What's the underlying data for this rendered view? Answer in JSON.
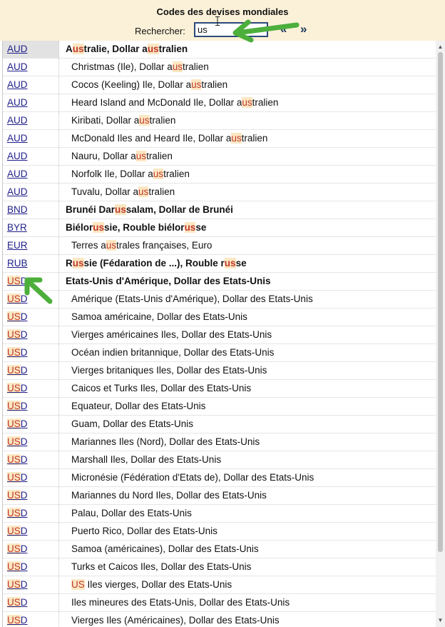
{
  "header": {
    "title": "Codes des devises mondiales",
    "search_label": "Rechercher:",
    "search_value": "us",
    "prev_label": "«",
    "next_label": "»"
  },
  "colors": {
    "header_bg": "#fbf1d8",
    "highlight_text": "#c0392b",
    "highlight_bg": "#fce7c2",
    "link": "#1f1f8a",
    "arrow": "#4caf3c"
  },
  "icons": [
    "text-cursor-icon",
    "scroll-up-icon",
    "scroll-down-icon",
    "pointer-arrow-icon"
  ],
  "rows": [
    {
      "code": "AUD",
      "name": "Australie, Dollar australien",
      "primary": true,
      "selected": true
    },
    {
      "code": "AUD",
      "name": "Christmas (Ile), Dollar australien",
      "primary": false
    },
    {
      "code": "AUD",
      "name": "Cocos (Keeling) Ile, Dollar australien",
      "primary": false
    },
    {
      "code": "AUD",
      "name": "Heard Island and McDonald Ile, Dollar australien",
      "primary": false
    },
    {
      "code": "AUD",
      "name": "Kiribati, Dollar australien",
      "primary": false
    },
    {
      "code": "AUD",
      "name": "McDonald Iles and Heard Ile, Dollar australien",
      "primary": false
    },
    {
      "code": "AUD",
      "name": "Nauru, Dollar australien",
      "primary": false
    },
    {
      "code": "AUD",
      "name": "Norfolk Ile, Dollar australien",
      "primary": false
    },
    {
      "code": "AUD",
      "name": "Tuvalu, Dollar australien",
      "primary": false
    },
    {
      "code": "BND",
      "name": "Brunéi Darussalam, Dollar de Brunéi",
      "primary": true
    },
    {
      "code": "BYR",
      "name": "Biélorussie, Rouble biélorusse",
      "primary": true
    },
    {
      "code": "EUR",
      "name": "Terres australes françaises, Euro",
      "primary": false
    },
    {
      "code": "RUB",
      "name": "Russie (Fédaration de ...), Rouble russe",
      "primary": true
    },
    {
      "code": "USD",
      "name": "Etats-Unis d'Amérique, Dollar des Etats-Unis",
      "primary": true
    },
    {
      "code": "USD",
      "name": "Amérique (Etats-Unis d'Amérique), Dollar des Etats-Unis",
      "primary": false
    },
    {
      "code": "USD",
      "name": "Samoa américaine, Dollar des Etats-Unis",
      "primary": false
    },
    {
      "code": "USD",
      "name": "Vierges américaines Iles, Dollar des Etats-Unis",
      "primary": false
    },
    {
      "code": "USD",
      "name": "Océan indien britannique, Dollar des Etats-Unis",
      "primary": false
    },
    {
      "code": "USD",
      "name": "Vierges britaniques Iles, Dollar des Etats-Unis",
      "primary": false
    },
    {
      "code": "USD",
      "name": "Caicos et Turks Iles, Dollar des Etats-Unis",
      "primary": false
    },
    {
      "code": "USD",
      "name": "Equateur, Dollar des Etats-Unis",
      "primary": false
    },
    {
      "code": "USD",
      "name": "Guam, Dollar des Etats-Unis",
      "primary": false
    },
    {
      "code": "USD",
      "name": "Mariannes Iles (Nord), Dollar des Etats-Unis",
      "primary": false
    },
    {
      "code": "USD",
      "name": "Marshall Iles, Dollar des Etats-Unis",
      "primary": false
    },
    {
      "code": "USD",
      "name": "Micronésie (Fédération d'Etats de), Dollar des Etats-Unis",
      "primary": false
    },
    {
      "code": "USD",
      "name": "Mariannes du Nord Iles, Dollar des Etats-Unis",
      "primary": false
    },
    {
      "code": "USD",
      "name": "Palau, Dollar des Etats-Unis",
      "primary": false
    },
    {
      "code": "USD",
      "name": "Puerto Rico, Dollar des Etats-Unis",
      "primary": false
    },
    {
      "code": "USD",
      "name": "Samoa (américaines), Dollar des Etats-Unis",
      "primary": false
    },
    {
      "code": "USD",
      "name": "Turks et Caicos Iles, Dollar des Etats-Unis",
      "primary": false
    },
    {
      "code": "USD",
      "name": "US Iles vierges, Dollar des Etats-Unis",
      "primary": false
    },
    {
      "code": "USD",
      "name": "Iles mineures des Etats-Unis, Dollar des Etats-Unis",
      "primary": false
    },
    {
      "code": "USD",
      "name": "Vierges Iles (Américaines), Dollar des Etats-Unis",
      "primary": false
    }
  ]
}
